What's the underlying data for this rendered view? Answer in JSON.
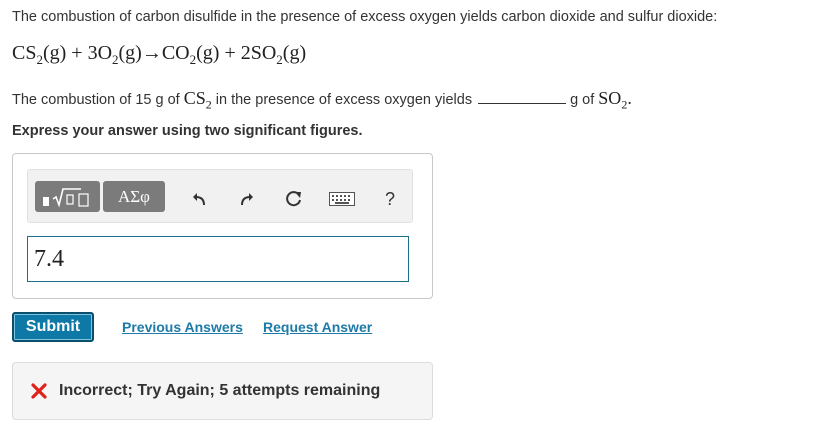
{
  "problem": {
    "intro": "The combustion of carbon disulfide in the presence of excess oxygen yields carbon dioxide and sulfur dioxide:",
    "question_prefix": "The combustion of 15 g of",
    "question_mid": "in the presence of excess oxygen yields",
    "question_unit": "g of",
    "instruction": "Express your answer using two significant figures."
  },
  "equation": {
    "t1": "CS",
    "s1": "2",
    "t2": "(g) + 3O",
    "s2": "2",
    "t3": "(g)→CO",
    "s3": "2",
    "t4": "(g) + 2SO",
    "s4": "2",
    "t5": "(g)"
  },
  "question_math": {
    "cs_base": "CS",
    "cs_sub": "2",
    "so_base": "SO",
    "so_sub": "2",
    "period": "."
  },
  "toolbar": {
    "greek_label": "ΑΣφ",
    "help_label": "?"
  },
  "answer": {
    "value": "7.4"
  },
  "actions": {
    "submit_label": "Submit",
    "previous_answers": "Previous Answers",
    "request_answer": "Request Answer"
  },
  "feedback": {
    "message": "Incorrect; Try Again; 5 attempts remaining",
    "icon_color": "#e0201b"
  },
  "colors": {
    "accent": "#0e79a6",
    "link": "#1e7aa8",
    "input_border": "#1b6f8b"
  }
}
